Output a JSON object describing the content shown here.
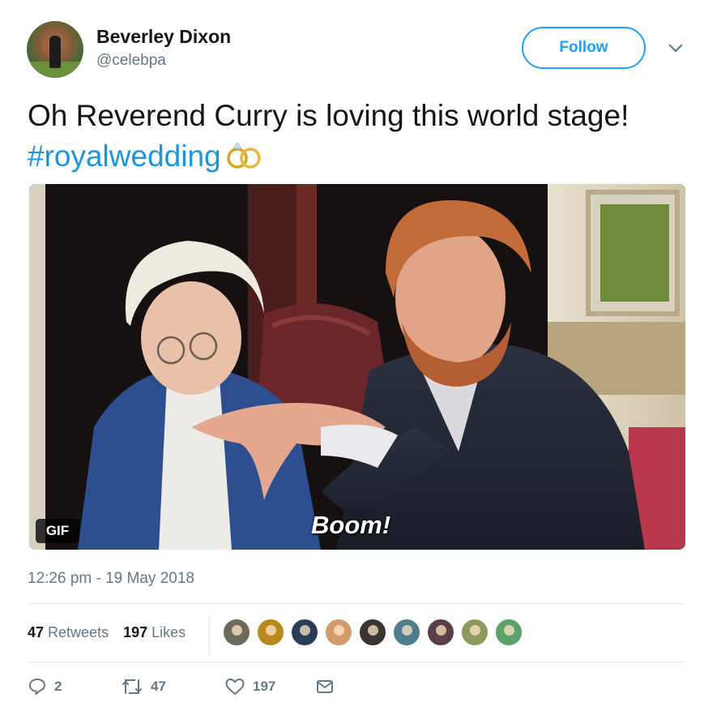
{
  "author": {
    "name": "Beverley Dixon",
    "handle": "@celebpa",
    "avatar_icon": "profile-photo"
  },
  "follow_button": {
    "label": "Follow"
  },
  "menu_icon": "chevron-down-icon",
  "tweet": {
    "text": "Oh Reverend Curry is loving this world stage!",
    "hashtag": "#royalwedding",
    "emoji": "rings-icon"
  },
  "media": {
    "badge": "GIF",
    "caption": "Boom!"
  },
  "timestamp": "12:26 pm - 19 May 2018",
  "stats": {
    "retweets_count": "47",
    "retweets_label": "Retweets",
    "likes_count": "197",
    "likes_label": "Likes"
  },
  "likers": [
    {
      "color": "#6d6a5c"
    },
    {
      "color": "#b78a1d"
    },
    {
      "color": "#2b3e57"
    },
    {
      "color": "#d39a6c"
    },
    {
      "color": "#3a3330"
    },
    {
      "color": "#4f7d8e"
    },
    {
      "color": "#5a3e4a"
    },
    {
      "color": "#8c9a5b"
    },
    {
      "color": "#5ca06a"
    }
  ],
  "actions": {
    "reply_count": "2",
    "retweet_count": "47",
    "like_count": "197"
  },
  "colors": {
    "accent": "#1da1f2",
    "hashtag": "#1b95e0",
    "secondary_text": "#657786"
  }
}
